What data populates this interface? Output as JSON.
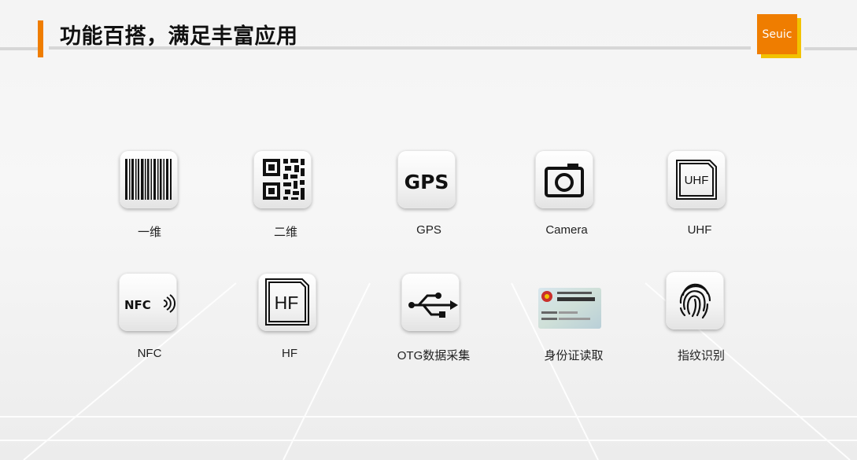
{
  "header": {
    "title": "功能百搭，满足丰富应用",
    "logo_text": "Seuic",
    "accent_color": "#ef7d00",
    "logo_shadow_color": "#f2c200"
  },
  "features": [
    {
      "label": "一维",
      "icon": "barcode-icon"
    },
    {
      "label": "二维",
      "icon": "qr-code-icon"
    },
    {
      "label": "GPS",
      "icon": "gps-icon",
      "icon_text": "GPS"
    },
    {
      "label": "Camera",
      "icon": "camera-icon"
    },
    {
      "label": "UHF",
      "icon": "uhf-tag-icon",
      "icon_text": "UHF"
    },
    {
      "label": "NFC",
      "icon": "nfc-icon",
      "icon_text": "NFC"
    },
    {
      "label": "HF",
      "icon": "hf-tag-icon",
      "icon_text": "HF"
    },
    {
      "label": "OTG数据采集",
      "icon": "usb-icon"
    },
    {
      "label": "身份证读取",
      "icon": "id-card-icon"
    },
    {
      "label": "指纹识别",
      "icon": "fingerprint-icon"
    }
  ]
}
